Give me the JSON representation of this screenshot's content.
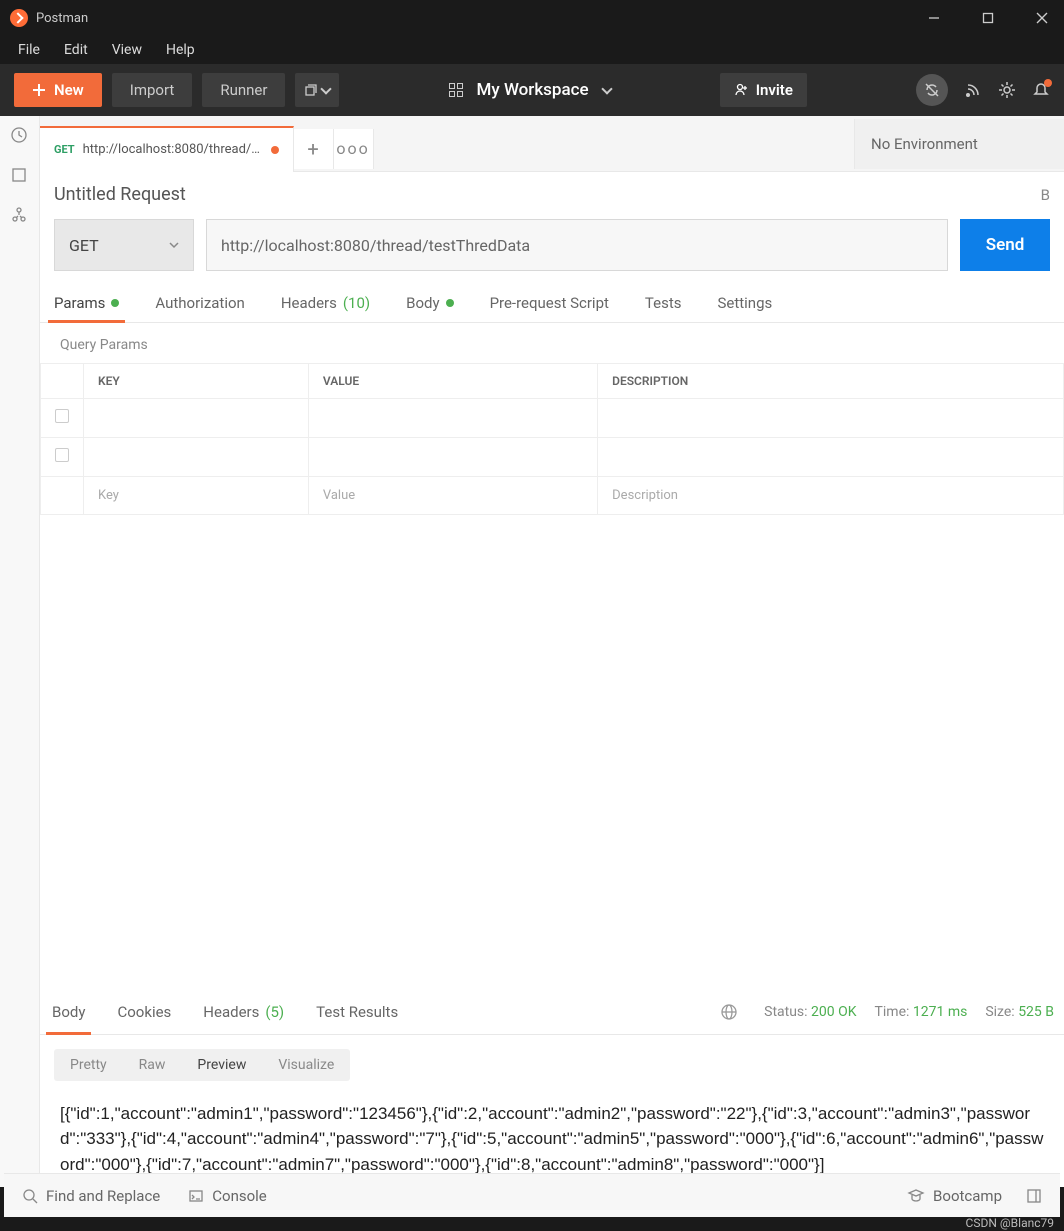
{
  "titlebar": {
    "app_name": "Postman"
  },
  "menubar": [
    "File",
    "Edit",
    "View",
    "Help"
  ],
  "toolbar": {
    "new_label": "New",
    "import_label": "Import",
    "runner_label": "Runner",
    "workspace_label": "My Workspace",
    "invite_label": "Invite"
  },
  "tabs": {
    "request_method": "GET",
    "request_url_short": "http://localhost:8080/thread/te...",
    "add": "+",
    "more": "ooo",
    "environment": "No Environment"
  },
  "request": {
    "name": "Untitled Request",
    "method": "GET",
    "url": "http://localhost:8080/thread/testThredData",
    "send_label": "Send",
    "right_letter": "B"
  },
  "request_tabs": {
    "params": "Params",
    "authorization": "Authorization",
    "headers": "Headers",
    "headers_count": "(10)",
    "body": "Body",
    "prerequest": "Pre-request Script",
    "tests": "Tests",
    "settings": "Settings"
  },
  "query_params": {
    "section_label": "Query Params",
    "headers": {
      "key": "KEY",
      "value": "VALUE",
      "description": "DESCRIPTION"
    },
    "placeholders": {
      "key": "Key",
      "value": "Value",
      "description": "Description"
    }
  },
  "response_tabs": {
    "body": "Body",
    "cookies": "Cookies",
    "headers": "Headers",
    "headers_count": "(5)",
    "test_results": "Test Results"
  },
  "response_status": {
    "status_label": "Status:",
    "status_value": "200 OK",
    "time_label": "Time:",
    "time_value": "1271 ms",
    "size_label": "Size:",
    "size_value": "525 B"
  },
  "view_tabs": {
    "pretty": "Pretty",
    "raw": "Raw",
    "preview": "Preview",
    "visualize": "Visualize"
  },
  "response_body": "[{\"id\":1,\"account\":\"admin1\",\"password\":\"123456\"},{\"id\":2,\"account\":\"admin2\",\"password\":\"22\"},{\"id\":3,\"account\":\"admin3\",\"password\":\"333\"},{\"id\":4,\"account\":\"admin4\",\"password\":\"7\"},{\"id\":5,\"account\":\"admin5\",\"password\":\"000\"},{\"id\":6,\"account\":\"admin6\",\"password\":\"000\"},{\"id\":7,\"account\":\"admin7\",\"password\":\"000\"},{\"id\":8,\"account\":\"admin8\",\"password\":\"000\"}]",
  "footer": {
    "find_replace": "Find and Replace",
    "console": "Console",
    "bootcamp": "Bootcamp"
  },
  "watermark": "CSDN @Blanc79"
}
